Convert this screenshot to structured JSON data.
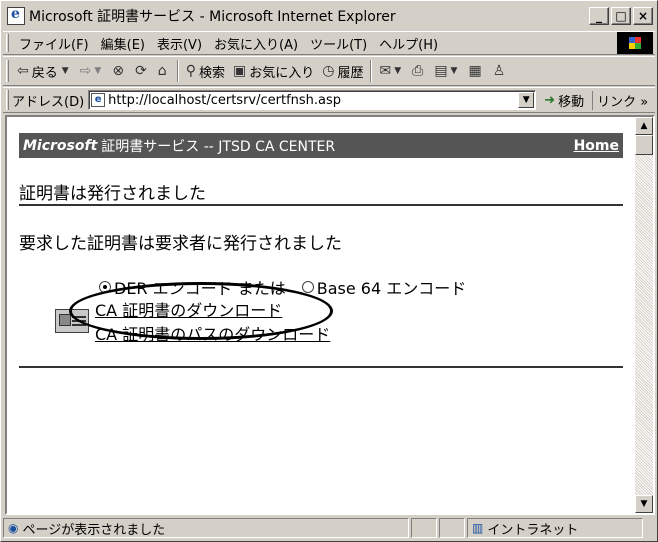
{
  "window": {
    "title": "Microsoft 証明書サービス - Microsoft Internet Explorer",
    "buttons": {
      "minimize": "_",
      "maximize": "□",
      "close": "×"
    }
  },
  "menubar": {
    "items": [
      {
        "label": "ファイル(F)"
      },
      {
        "label": "編集(E)"
      },
      {
        "label": "表示(V)"
      },
      {
        "label": "お気に入り(A)"
      },
      {
        "label": "ツール(T)"
      },
      {
        "label": "ヘルプ(H)"
      }
    ]
  },
  "toolbar": {
    "back": "戻る",
    "search": "検索",
    "favorites": "お気に入り",
    "history": "履歴"
  },
  "addressbar": {
    "label": "アドレス(D)",
    "url": "http://localhost/certsrv/certfnsh.asp",
    "go": "移動",
    "links": "リンク »"
  },
  "page": {
    "banner": {
      "brand": "Microsoft",
      "service": "証明書サービス  --  JTSD CA CENTER",
      "home": "Home"
    },
    "heading": "証明書は発行されました",
    "message": "要求した証明書は要求者に発行されました",
    "encoding": {
      "options": [
        {
          "label": "DER エンコード  または",
          "selected": true
        },
        {
          "label": "Base 64 エンコード",
          "selected": false
        }
      ]
    },
    "links": {
      "download_cert": "CA 証明書のダウンロード",
      "download_chain": "CA 証明書のパスのダウンロード"
    }
  },
  "statusbar": {
    "message": "ページが表示されました",
    "zone": "イントラネット"
  }
}
